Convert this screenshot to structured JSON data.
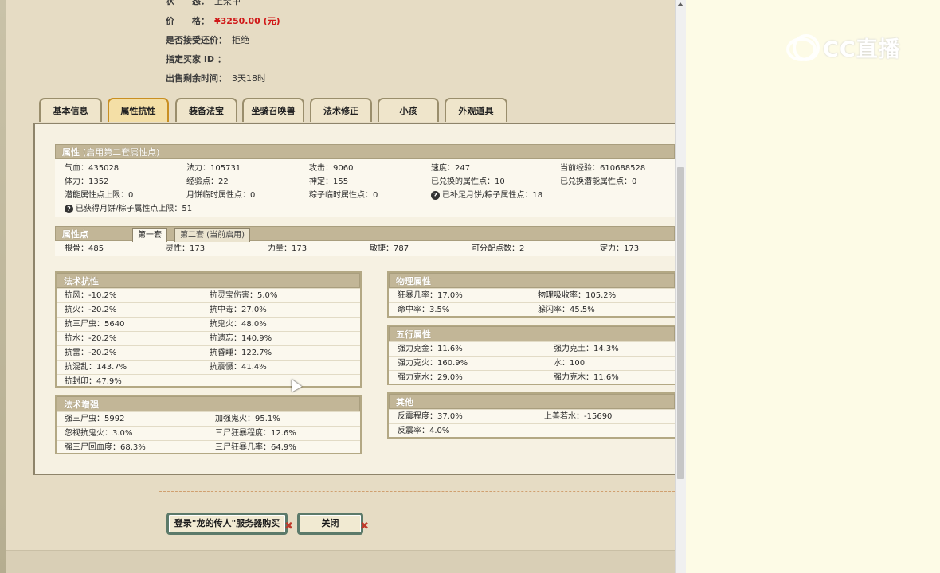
{
  "header": {
    "status_key": "状　　态：",
    "status_value": "上架中",
    "price_key": "价　　格：",
    "price_value": "¥3250.00 (元)",
    "counter_key": "是否接受还价：",
    "counter_value": "拒绝",
    "buyer_key": "指定买家 ID ：",
    "buyer_value": "",
    "remain_key": "出售剩余时间：",
    "remain_value": "3天18时"
  },
  "tabs": [
    "基本信息",
    "属性抗性",
    "装备法宝",
    "坐骑召唤兽",
    "法术修正",
    "小孩",
    "外观道具"
  ],
  "active_tab": "属性抗性",
  "attributes": {
    "title": "属性",
    "subtitle": "(启用第二套属性点)",
    "rows": [
      [
        "气血：435028",
        "法力：105731",
        "攻击：9060",
        "速度：247",
        "当前经验：610688528"
      ],
      [
        "体力：1352",
        "经验点：22",
        "神定：155",
        "已兑换的属性点：10",
        "已兑换潜能属性点：0"
      ],
      [
        "潜能属性点上限：0",
        "月饼临时属性点：0",
        "粽子临时属性点：0",
        "已补足月饼/粽子属性点：18"
      ]
    ],
    "footnote": "已获得月饼/粽子属性点上限：51"
  },
  "points": {
    "title": "属性点",
    "subtab1": "第一套",
    "subtab2": "第二套 (当前启用)",
    "row": [
      "根骨：485",
      "灵性：173",
      "力量：173",
      "敏捷：787",
      "可分配点数：2",
      "定力：173"
    ]
  },
  "spell_resist": {
    "title": "法术抗性",
    "rows": [
      [
        "抗风：-10.2%",
        "抗灵宝伤害：5.0%"
      ],
      [
        "抗火：-20.2%",
        "抗中毒：27.0%"
      ],
      [
        "抗三尸虫：5640",
        "抗鬼火：48.0%"
      ],
      [
        "抗水：-20.2%",
        "抗遗忘：140.9%"
      ],
      [
        "抗雷：-20.2%",
        "抗昏睡：122.7%"
      ],
      [
        "抗混乱：143.7%",
        "抗震慑：41.4%"
      ],
      [
        "抗封印：47.9%",
        ""
      ]
    ]
  },
  "spell_boost": {
    "title": "法术增强",
    "rows": [
      [
        "强三尸虫：5992",
        "加强鬼火：95.1%"
      ],
      [
        "忽视抗鬼火：3.0%",
        "三尸狂暴程度：12.6%"
      ],
      [
        "强三尸回血度：68.3%",
        "三尸狂暴几率：64.9%"
      ]
    ]
  },
  "physical": {
    "title": "物理属性",
    "rows": [
      [
        "狂暴几率：17.0%",
        "物理吸收率：105.2%"
      ],
      [
        "命中率：3.5%",
        "躲闪率：45.5%"
      ]
    ]
  },
  "five_elements": {
    "title": "五行属性",
    "rows": [
      [
        "强力克金：11.6%",
        "强力克土：14.3%"
      ],
      [
        "强力克火：160.9%",
        "水：100"
      ],
      [
        "强力克水：29.0%",
        "强力克木：11.6%"
      ]
    ]
  },
  "other": {
    "title": "其他",
    "rows": [
      [
        "反震程度：37.0%",
        "上善若水：-15690"
      ],
      [
        "反震率：4.0%",
        ""
      ]
    ]
  },
  "buttons": {
    "buy": "登录\"龙的传人\"服务器购买",
    "close": "关闭"
  },
  "watermark": "CC直播"
}
